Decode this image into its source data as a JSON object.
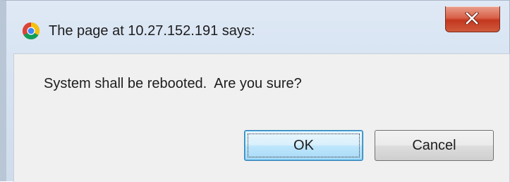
{
  "dialog": {
    "title": "The page at 10.27.152.191 says:",
    "message": "System shall be rebooted.  Are you sure?",
    "buttons": {
      "ok_label": "OK",
      "cancel_label": "Cancel"
    },
    "close_icon": "close-icon",
    "browser_icon": "chrome-icon"
  },
  "colors": {
    "close_button_red": "#c4371f",
    "default_button_blue": "#48b2e8",
    "content_background": "#f0f0f0"
  }
}
